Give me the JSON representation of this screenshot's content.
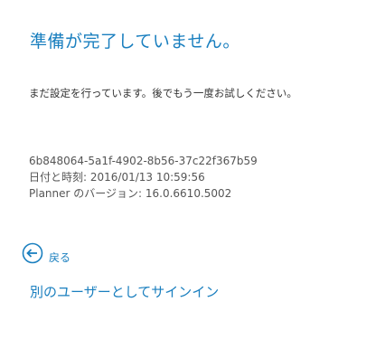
{
  "title": "準備が完了していません。",
  "message": "まだ設定を行っています。後でもう一度お試しください。",
  "info": {
    "id": "6b848064-5a1f-4902-8b56-37c22f367b59",
    "datetime": "日付と時刻: 2016/01/13 10:59:56",
    "version": "Planner のバージョン: 16.0.6610.5002"
  },
  "back": {
    "label": "戻る",
    "icon": "back-arrow-circle"
  },
  "signin_link": "別のユーザーとしてサインイン",
  "colors": {
    "accent": "#1a7fbf",
    "text": "#333333",
    "muted": "#555555"
  }
}
